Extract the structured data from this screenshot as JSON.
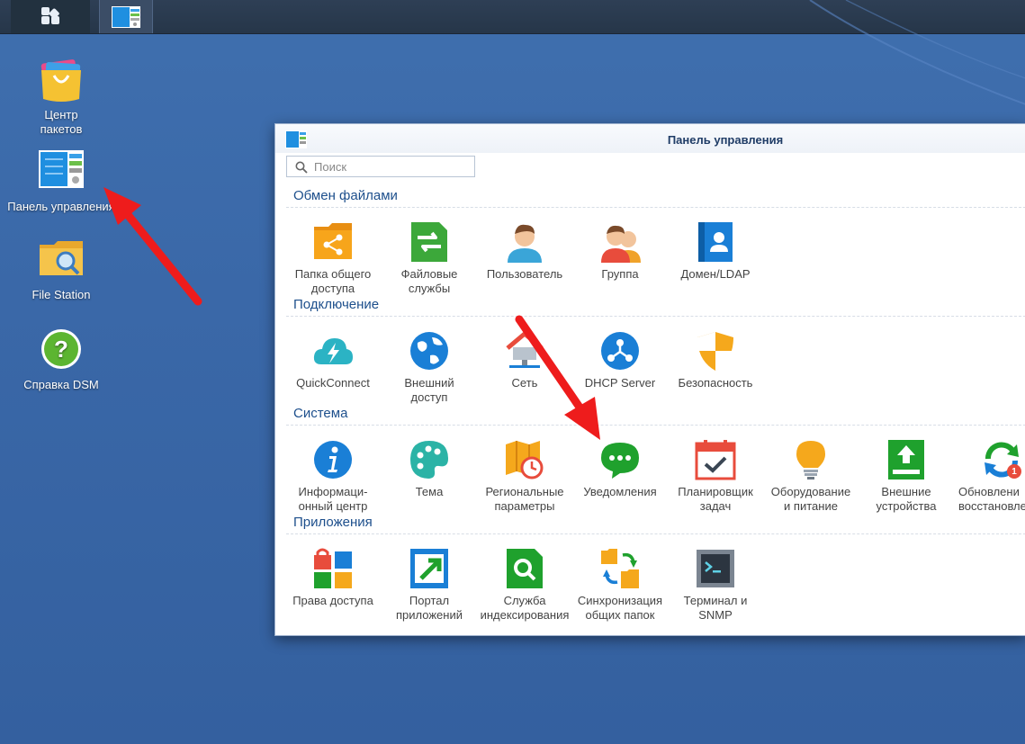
{
  "colors": {
    "desktop": "#3a68a8",
    "taskbar": "#263649",
    "window_title_text": "#1f3c66",
    "section_text": "#1d4f8c",
    "arrow": "#ee1c1c"
  },
  "taskbar": {
    "main_menu_icon": "grid-icon",
    "control_panel_icon": "control-panel-icon"
  },
  "desktop": {
    "icons": [
      {
        "label": "Центр\nпакетов",
        "icon": "package-center-icon"
      },
      {
        "label": "Панель управления",
        "icon": "control-panel-icon"
      },
      {
        "label": "File Station",
        "icon": "folder-search-icon"
      },
      {
        "label": "Справка DSM",
        "icon": "help-icon"
      }
    ]
  },
  "window": {
    "title": "Панель управления",
    "search_placeholder": "Поиск",
    "sections": [
      {
        "title": "Обмен файлами",
        "items": [
          {
            "label": "Папка общего\nдоступа",
            "icon": "shared-folder-icon"
          },
          {
            "label": "Файловые\nслужбы",
            "icon": "file-services-icon"
          },
          {
            "label": "Пользователь",
            "icon": "user-icon"
          },
          {
            "label": "Группа",
            "icon": "group-icon"
          },
          {
            "label": "Домен/LDAP",
            "icon": "domain-ldap-icon"
          }
        ]
      },
      {
        "title": "Подключение",
        "items": [
          {
            "label": "QuickConnect",
            "icon": "quickconnect-icon"
          },
          {
            "label": "Внешний\nдоступ",
            "icon": "globe-icon"
          },
          {
            "label": "Сеть",
            "icon": "network-icon"
          },
          {
            "label": "DHCP Server",
            "icon": "dhcp-icon"
          },
          {
            "label": "Безопасность",
            "icon": "shield-icon"
          }
        ]
      },
      {
        "title": "Система",
        "items": [
          {
            "label": "Информаци-\nонный центр",
            "icon": "info-icon"
          },
          {
            "label": "Тема",
            "icon": "palette-icon"
          },
          {
            "label": "Региональные\nпараметры",
            "icon": "regional-icon"
          },
          {
            "label": "Уведомления",
            "icon": "chat-icon"
          },
          {
            "label": "Планировщик\nзадач",
            "icon": "calendar-check-icon"
          },
          {
            "label": "Оборудование\nи питание",
            "icon": "bulb-icon"
          },
          {
            "label": "Внешние\nустройства",
            "icon": "external-device-icon"
          },
          {
            "label": "Обновлени\nвосстановле",
            "icon": "update-icon",
            "badge": "1"
          }
        ]
      },
      {
        "title": "Приложения",
        "items": [
          {
            "label": "Права доступа",
            "icon": "privileges-icon"
          },
          {
            "label": "Портал\nприложений",
            "icon": "portal-icon"
          },
          {
            "label": "Служба\nиндексирования",
            "icon": "index-icon"
          },
          {
            "label": "Синхронизация\nобщих папок",
            "icon": "sync-icon"
          },
          {
            "label": "Терминал и\nSNMP",
            "icon": "terminal-icon"
          }
        ]
      }
    ]
  }
}
